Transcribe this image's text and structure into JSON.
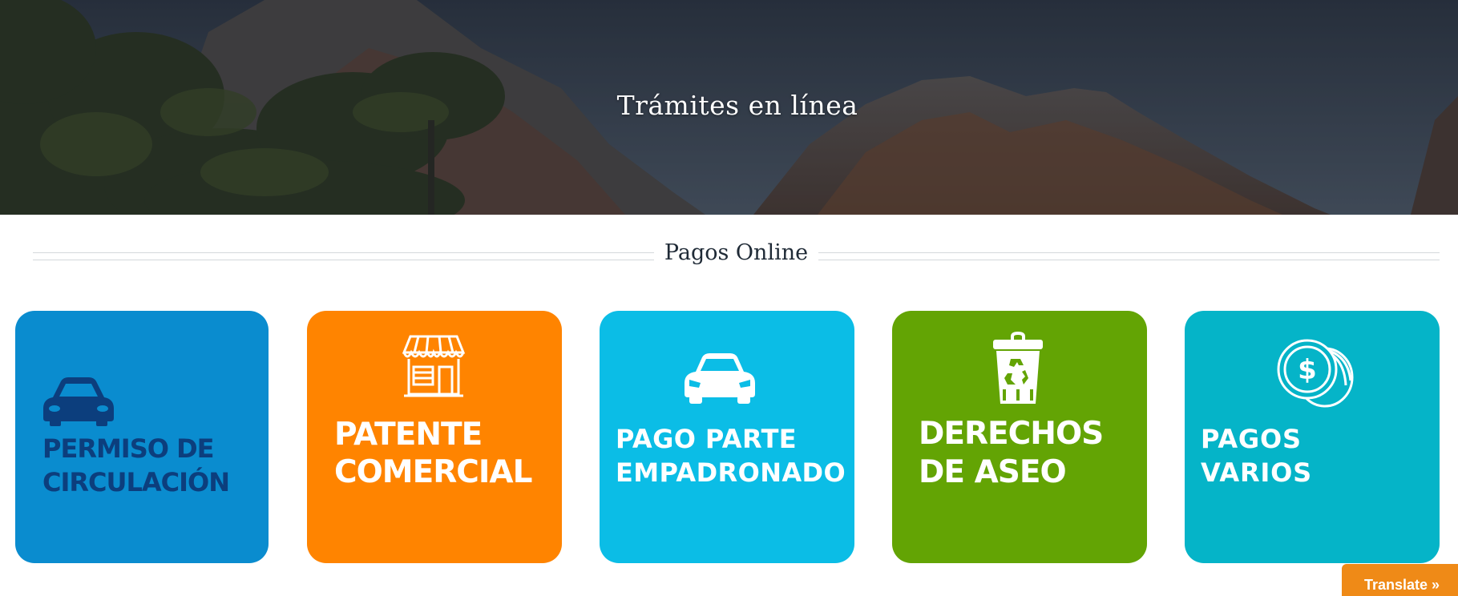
{
  "hero": {
    "title": "Trámites en línea"
  },
  "section": {
    "title": "Pagos Online"
  },
  "cards": [
    {
      "line1": "PERMISO DE",
      "line2": "CIRCULACIÓN",
      "color": "#0a8ccf",
      "icon": "car-icon"
    },
    {
      "line1": "PATENTE",
      "line2": "COMERCIAL",
      "color": "#ff8400",
      "icon": "shop-icon"
    },
    {
      "line1": "PAGO PARTE",
      "line2": "EMPADRONADO",
      "color": "#0bbde6",
      "icon": "car-front-icon"
    },
    {
      "line1": "DERECHOS",
      "line2": "DE ASEO",
      "color": "#63a404",
      "icon": "recycle-bin-icon"
    },
    {
      "line1": "PAGOS",
      "line2": "VARIOS",
      "color": "#05b4c8",
      "icon": "coin-dollar-icon"
    }
  ],
  "translate": {
    "label": "Translate »",
    "color": "#ef8a17"
  }
}
